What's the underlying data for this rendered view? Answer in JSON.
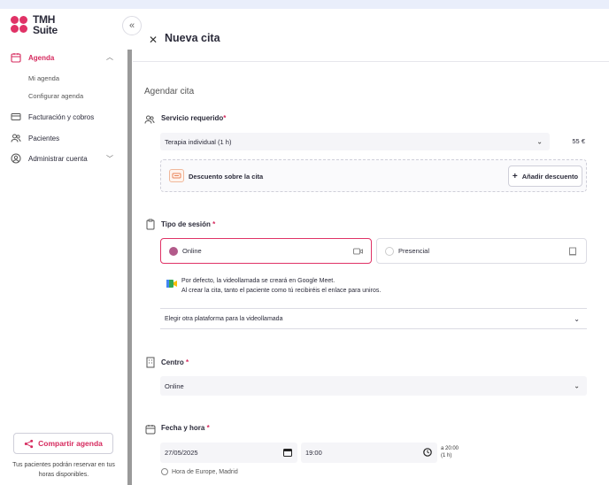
{
  "app": {
    "logo_line1": "TMH",
    "logo_line2": "Suite"
  },
  "sidebar": {
    "collapse_icon": "double-chevron-left-icon",
    "items": [
      {
        "label": "Agenda",
        "icon": "calendar-icon",
        "active": true
      },
      {
        "label": "Facturación y cobros",
        "icon": "card-icon"
      },
      {
        "label": "Pacientes",
        "icon": "users-icon"
      },
      {
        "label": "Administrar cuenta",
        "icon": "user-circle-icon"
      }
    ],
    "sub_items": [
      "Mi agenda",
      "Configurar agenda"
    ],
    "share_button": "Compartir agenda",
    "share_note": "Tus pacientes podrán reservar en tus horas disponibles."
  },
  "modal": {
    "title": "Nueva cita",
    "section_title": "Agendar cita",
    "service": {
      "label": "Servicio requerido",
      "required_mark": "*",
      "value": "Terapia individual (1 h)",
      "price": "55 €",
      "discount_label": "Descuento sobre la cita",
      "add_discount_button": "Añadir descuento"
    },
    "session": {
      "label": "Tipo de sesión",
      "required_mark": "*",
      "options": [
        "Online",
        "Presencial"
      ],
      "selected": "Online",
      "meet_line1": "Por defecto, la videollamada se creará en Google Meet.",
      "meet_line2": "Al crear la cita, tanto el paciente como tú recibiréis el enlace para uniros.",
      "platform_select": "Elegir otra plataforma para la videollamada"
    },
    "center": {
      "label": "Centro",
      "required_mark": "*",
      "value": "Online"
    },
    "datetime": {
      "label": "Fecha y hora",
      "required_mark": "*",
      "date": "27/05/2025",
      "time": "19:00",
      "end_line1": "a 20:00",
      "end_line2": "(1 h)",
      "timezone": "Hora de Europe, Madrid"
    }
  },
  "colors": {
    "accent": "#e03266",
    "accent_text": "#d62a5e",
    "field_bg": "#f5f5f8"
  }
}
